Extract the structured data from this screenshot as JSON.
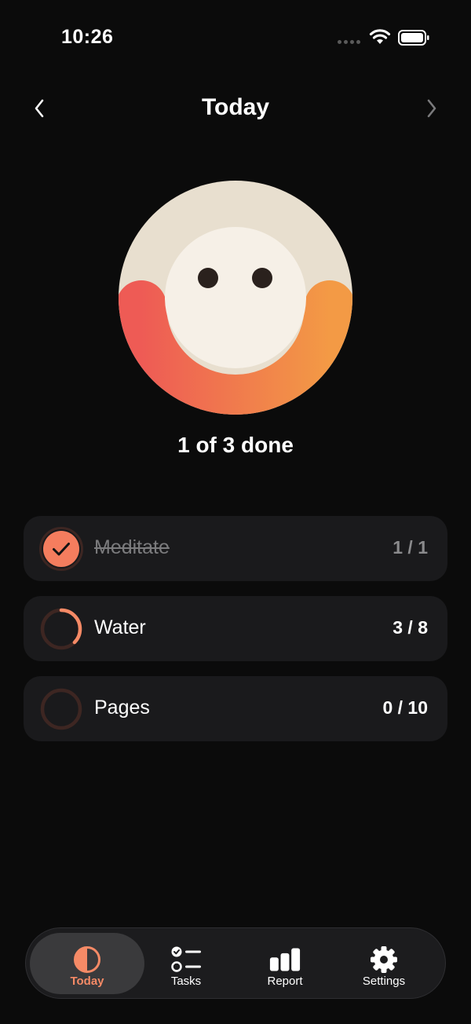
{
  "status_bar": {
    "time": "10:26"
  },
  "header": {
    "title": "Today"
  },
  "summary": {
    "done_text": "1 of 3 done",
    "completed": 1,
    "total": 3
  },
  "habits": [
    {
      "name": "Meditate",
      "count": "1 / 1",
      "progress": 1.0,
      "completed": true
    },
    {
      "name": "Water",
      "count": "3 / 8",
      "progress": 0.375,
      "completed": false
    },
    {
      "name": "Pages",
      "count": "0 / 10",
      "progress": 0.0,
      "completed": false
    }
  ],
  "tabs": [
    {
      "label": "Today",
      "icon": "half-circle-icon",
      "active": true
    },
    {
      "label": "Tasks",
      "icon": "checklist-icon",
      "active": false
    },
    {
      "label": "Report",
      "icon": "bar-chart-icon",
      "active": false
    },
    {
      "label": "Settings",
      "icon": "gear-icon",
      "active": false
    }
  ],
  "colors": {
    "background": "#0b0b0b",
    "card": "#1a1a1c",
    "accent": "#f58a66",
    "ring_track": "#3d2622",
    "gradient_start": "#ee5b55",
    "gradient_end": "#f39a45",
    "face_outer": "#e8dfcf",
    "face_inner": "#f6f0e7"
  }
}
